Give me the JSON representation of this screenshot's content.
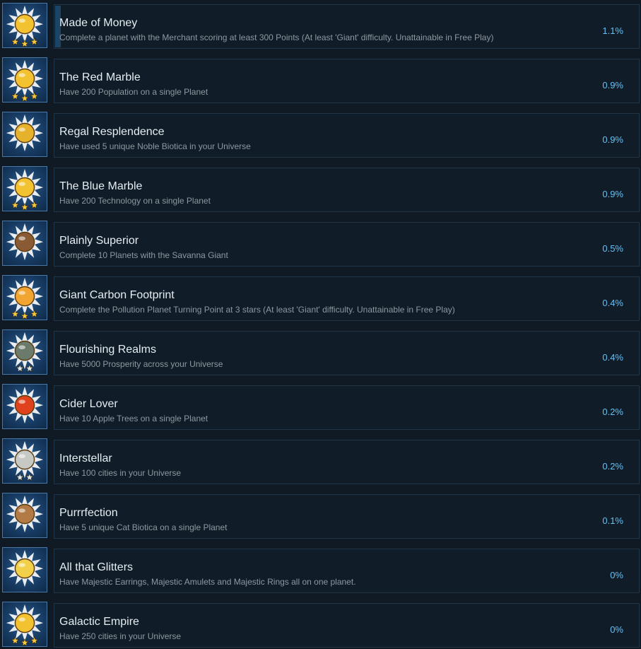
{
  "achievements": [
    {
      "title": "Made of Money",
      "description": "Complete a planet with the Merchant scoring at least 300 Points (At least 'Giant' difficulty. Unattainable in Free Play)",
      "percent": "1.1%",
      "icon": "gold-merchant-icon",
      "progress": 0.01,
      "stars": 3,
      "color": "#f2c230"
    },
    {
      "title": "The Red Marble",
      "description": "Have 200 Population on a single Planet",
      "percent": "0.9%",
      "icon": "gold-population-icon",
      "stars": 3,
      "color": "#f2c230"
    },
    {
      "title": "Regal Resplendence",
      "description": "Have used 5 unique Noble Biotica in your Universe",
      "percent": "0.9%",
      "icon": "gold-bar-gem-icon",
      "stars": 0,
      "color": "#e6b22c"
    },
    {
      "title": "The Blue Marble",
      "description": "Have 200 Technology on a single Planet",
      "percent": "0.9%",
      "icon": "gold-gear-icon",
      "stars": 3,
      "color": "#f2c230"
    },
    {
      "title": "Plainly Superior",
      "description": "Complete 10 Planets with the Savanna Giant",
      "percent": "0.5%",
      "icon": "savanna-giant-icon",
      "stars": 0,
      "color": "#8a5a35"
    },
    {
      "title": "Giant Carbon Footprint",
      "description": "Complete the Pollution Planet Turning Point at 3 stars (At least 'Giant' difficulty. Unattainable in Free Play)",
      "percent": "0.4%",
      "icon": "gold-pollution-icon",
      "stars": 3,
      "color": "#f2a530"
    },
    {
      "title": "Flourishing Realms",
      "description": "Have 5000 Prosperity across your Universe",
      "percent": "0.4%",
      "icon": "realm-island-icon",
      "stars": 2,
      "color": "#6b7a6a"
    },
    {
      "title": "Cider Lover",
      "description": "Have 10 Apple Trees on a single Planet",
      "percent": "0.2%",
      "icon": "apple-icon",
      "stars": 0,
      "color": "#e0421e"
    },
    {
      "title": "Interstellar",
      "description": "Have 100 cities in your Universe",
      "percent": "0.2%",
      "icon": "silver-city-icon",
      "stars": 2,
      "color": "#c7c9c4"
    },
    {
      "title": "Purrrfection",
      "description": "Have 5 unique Cat Biotica on a single Planet",
      "percent": "0.1%",
      "icon": "cat-icon",
      "stars": 0,
      "color": "#b27a45"
    },
    {
      "title": "All that Glitters",
      "description": "Have Majestic Earrings, Majestic Amulets and Majestic Rings all on one planet.",
      "percent": "0%",
      "icon": "gold-ring-gem-icon",
      "stars": 0,
      "color": "#f2d04a"
    },
    {
      "title": "Galactic Empire",
      "description": "Have 250 cities in your Universe",
      "percent": "0%",
      "icon": "gold-city-icon",
      "stars": 3,
      "color": "#f2c230"
    }
  ]
}
